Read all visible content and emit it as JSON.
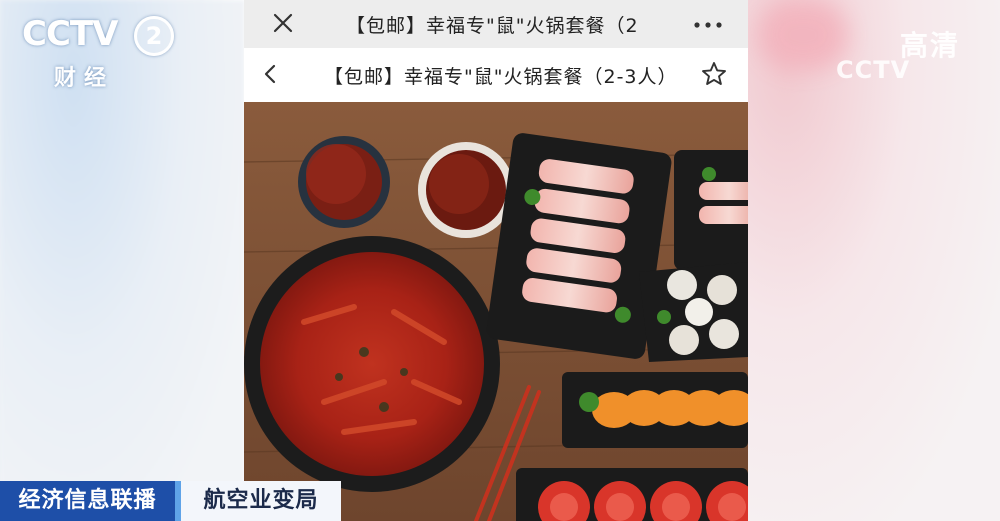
{
  "broadcast": {
    "channel_logo": "CCTV",
    "channel_number": "2",
    "channel_name": "财经",
    "hd_label": "高清",
    "hd_logo": "CCTV",
    "program_name": "经济信息联播",
    "topic": "航空业变局"
  },
  "webview": {
    "title": "【包邮】幸福专\"鼠\"火锅套餐（2",
    "close_icon": "close-icon",
    "more_icon": "more-icon"
  },
  "page": {
    "title": "【包邮】幸福专\"鼠\"火锅套餐（2-3人）",
    "back_icon": "back-arrow-icon",
    "favorite_icon": "star-icon"
  },
  "colors": {
    "lower_third_blue": "#1e4fa8",
    "lower_third_accent": "#5fa3e8",
    "webview_bar": "#ededed",
    "table_wood": "#7a4e33"
  }
}
